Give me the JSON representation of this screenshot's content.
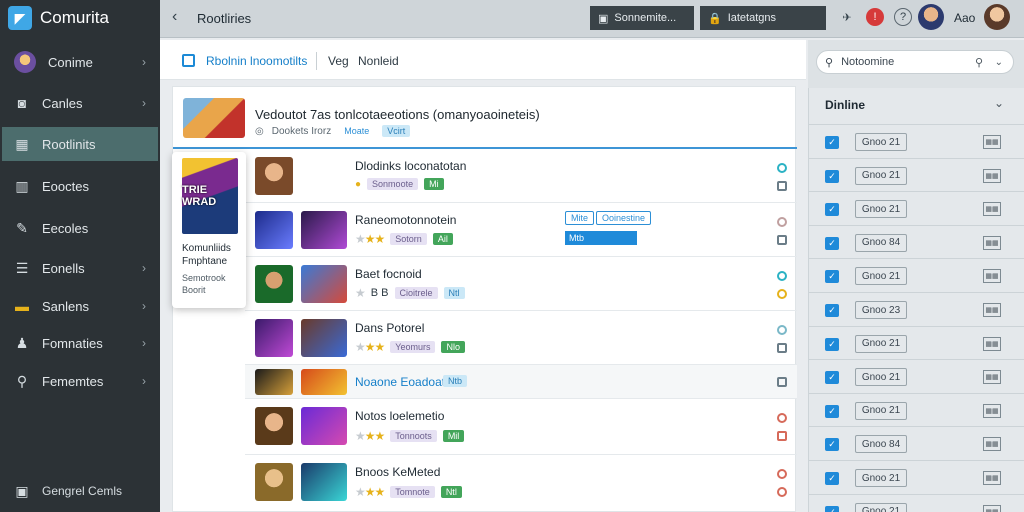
{
  "app": {
    "name": "Comurita"
  },
  "sidebar": {
    "items": [
      {
        "label": "Conime",
        "icon": "avatar"
      },
      {
        "label": "Canles",
        "icon": "camera-icon"
      },
      {
        "label": "Rootlinits",
        "icon": "grid-icon",
        "active": true
      },
      {
        "label": "Eooctes",
        "icon": "chart-icon"
      },
      {
        "label": "Eecoles",
        "icon": "edit-icon"
      },
      {
        "label": "Eonells",
        "icon": "sliders-icon"
      },
      {
        "label": "Sanlens",
        "icon": "folder-icon"
      },
      {
        "label": "Fomnaties",
        "icon": "users-icon"
      },
      {
        "label": "Fememtes",
        "icon": "wrench-icon"
      }
    ],
    "footer": "Gengrel Cemls"
  },
  "topbar": {
    "title": "Rootliries",
    "field1": "Sonnemite...",
    "field2": "Iatetatgns",
    "user": "Aao"
  },
  "tabs": [
    {
      "label": "Rbolnin lnoomotilts",
      "active": true
    },
    {
      "label": "Veg"
    },
    {
      "label": "Nonleid"
    }
  ],
  "header_item": {
    "title": "Vedoutot 7as tonlcotaeeotions (omanyoaoineteis)",
    "meta": "Dookets Irorz",
    "pill1": "Moate",
    "pill2": "Vcirt"
  },
  "float_card": {
    "cover": "TRIE WRAD",
    "title": "Komunliids Fmphtane",
    "sub": "Semotrook Boorit"
  },
  "rows": [
    {
      "title": "Dlodinks loconatotan",
      "pill_a": "Sonmoote",
      "pill_b": "Mi",
      "stars": 0,
      "action": "circle-cyan"
    },
    {
      "title": "Raneomotonnotein",
      "pill_a": "Sotorn",
      "pill_b": "Ail",
      "stars": 2,
      "action": "circle-gray",
      "tags": [
        "Mite",
        "Ooinestine"
      ],
      "status": "Mtb"
    },
    {
      "title": "Baet focnoid",
      "pill_a": "Cioitrele",
      "pill_b": "Ntl",
      "stars": 0,
      "extra": "B B",
      "action": "circle-cyan"
    },
    {
      "title": "Dans Potorel",
      "pill_a": "Yeomurs",
      "pill_b": "Nlo",
      "stars": 2,
      "action": "circle-gray"
    },
    {
      "title": "Noaone Eoadoat",
      "pill_b": "Ntb",
      "stars": 0,
      "action": "square"
    },
    {
      "title": "Notos loelemetio",
      "pill_a": "Tonnoots",
      "pill_b": "Mil",
      "stars": 2,
      "action": "circle-red"
    },
    {
      "title": "Bnoos KeMeted",
      "pill_a": "Tomnote",
      "pill_b": "Ntl",
      "stars": 2,
      "action": "circle-red"
    }
  ],
  "right_panel": {
    "search": "Notoomine",
    "heading": "Dinline",
    "rows": [
      "Gnoo 21",
      "Gnoo 21",
      "Gnoo 21",
      "Gnoo 84",
      "Gnoo 21",
      "Gnoo 23",
      "Gnoo 21",
      "Gnoo 21",
      "Gnoo 21",
      "Gnoo 84",
      "Gnoo 21",
      "Gnoo 21"
    ]
  },
  "colors": {
    "accent": "#1f8ad9",
    "sidebar_bg": "#2c3236",
    "active_nav": "#4c6d6d"
  }
}
